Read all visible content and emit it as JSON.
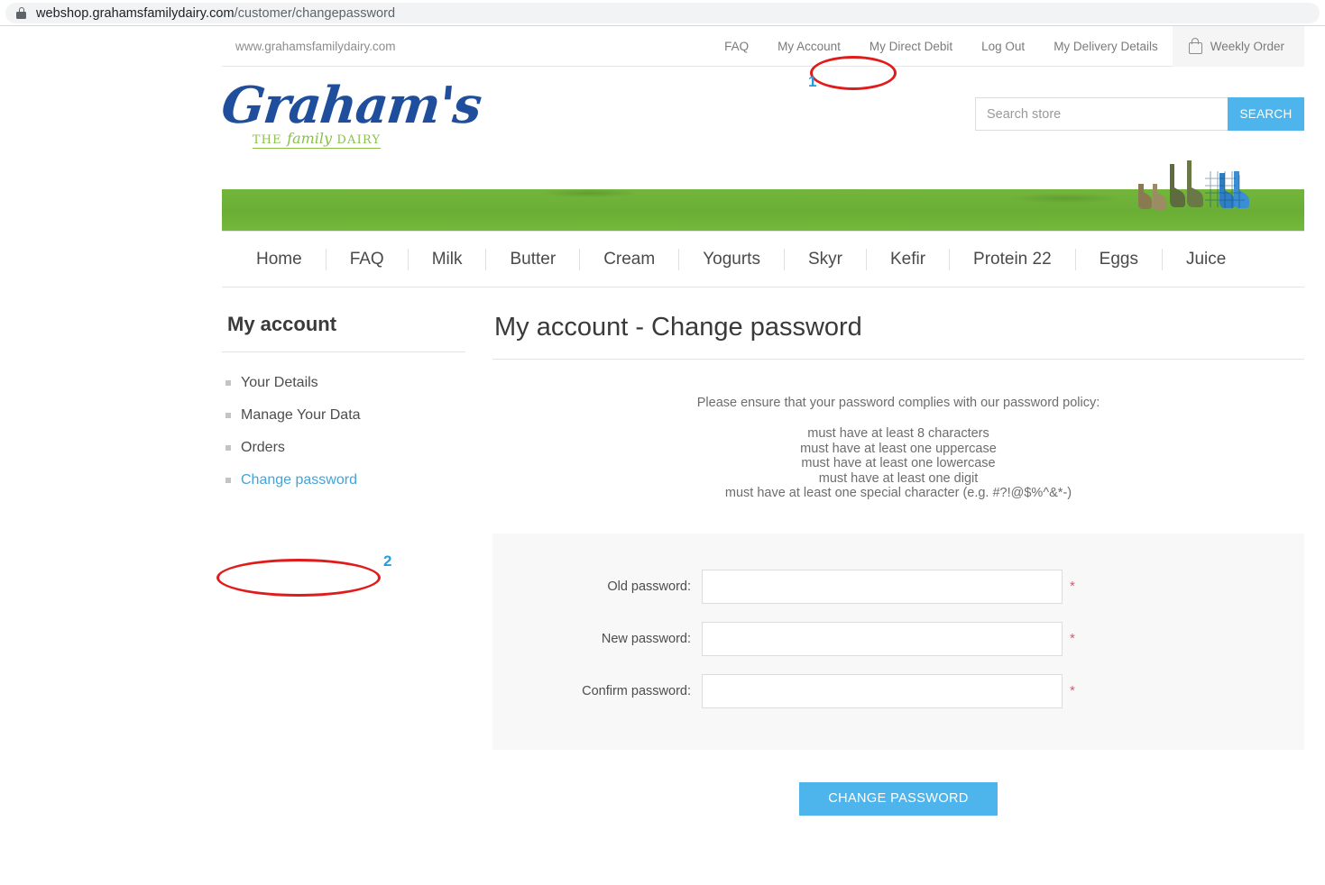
{
  "browser": {
    "url_host": "webshop.grahamsfamilydairy.com",
    "url_path": "/customer/changepassword",
    "lock_icon": "lock-icon"
  },
  "topbar": {
    "site_url": "www.grahamsfamilydairy.com",
    "links": [
      {
        "label": "FAQ"
      },
      {
        "label": "My Account"
      },
      {
        "label": "My Direct Debit"
      },
      {
        "label": "Log Out"
      },
      {
        "label": "My Delivery Details"
      }
    ],
    "cart": {
      "label": "Weekly Order",
      "icon": "shopping-bag-icon"
    }
  },
  "brand": {
    "name": "Graham's",
    "tagline_the": "THE ",
    "tagline_family": "family",
    "tagline_dairy": " DAIRY"
  },
  "search": {
    "placeholder": "Search store",
    "value": "",
    "button_label": "SEARCH",
    "accent": "#4db4ec"
  },
  "mainnav": {
    "items": [
      {
        "label": "Home"
      },
      {
        "label": "FAQ"
      },
      {
        "label": "Milk"
      },
      {
        "label": "Butter"
      },
      {
        "label": "Cream"
      },
      {
        "label": "Yogurts"
      },
      {
        "label": "Skyr"
      },
      {
        "label": "Kefir"
      },
      {
        "label": "Protein 22"
      },
      {
        "label": "Eggs"
      },
      {
        "label": "Juice"
      }
    ]
  },
  "sidebar": {
    "title": "My account",
    "items": [
      {
        "label": "Your Details",
        "active": false
      },
      {
        "label": "Manage Your Data",
        "active": false
      },
      {
        "label": "Orders",
        "active": false
      },
      {
        "label": "Change password",
        "active": true
      }
    ],
    "active_color": "#45a3d8"
  },
  "main": {
    "title": "My account - Change password",
    "policy_intro": "Please ensure that your password complies with our password policy:",
    "policy_rules": [
      "must have at least 8 characters",
      "must have at least one uppercase",
      "must have at least one lowercase",
      "must have at least one digit",
      "must have at least one special character (e.g. #?!@$%^&*-)"
    ],
    "form": {
      "fields": [
        {
          "label": "Old password:",
          "value": "",
          "required_mark": "*"
        },
        {
          "label": "New password:",
          "value": "",
          "required_mark": "*"
        },
        {
          "label": "Confirm password:",
          "value": "",
          "required_mark": "*"
        }
      ],
      "submit_label": "CHANGE PASSWORD"
    }
  },
  "annotations": {
    "color": "#e01b1b",
    "marker_color": "#1f9fe0",
    "items": [
      {
        "marker": "1",
        "target": "My Account"
      },
      {
        "marker": "2",
        "target": "Change password"
      }
    ]
  }
}
